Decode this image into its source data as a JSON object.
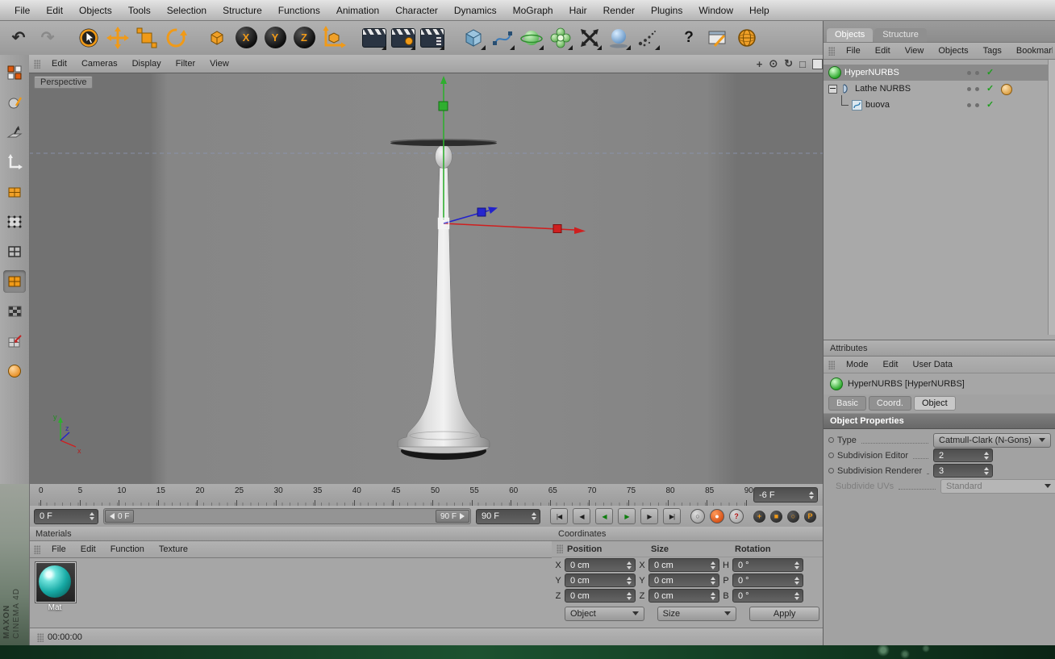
{
  "colors": {
    "accent": "#f09a18",
    "material_teal": "#17a9a4",
    "desktop_green": "#16402a",
    "axis_x": "#cf1f1f",
    "axis_y": "#2fae2f",
    "axis_z": "#2222cc"
  },
  "icons": {
    "undo": "↶",
    "redo": "↷",
    "nav_pan": "+",
    "nav_zoom": "⊙",
    "nav_rotate": "↻",
    "nav_max": "□",
    "goto_start": "|◀",
    "prev_frame": "◀",
    "play_backward": "◀",
    "play_forward": "▶",
    "next_frame": "▶",
    "goto_end": "▶|",
    "autokey": "○",
    "record": "●",
    "keyframe_help": "?",
    "key_position": "+",
    "key_scale": "■",
    "key_rotation": "○",
    "key_parameter": "P",
    "pencil": "╱",
    "check": "✓",
    "help": "?"
  },
  "menubar": {
    "items": [
      "File",
      "Edit",
      "Objects",
      "Tools",
      "Selection",
      "Structure",
      "Functions",
      "Animation",
      "Character",
      "Dynamics",
      "MoGraph",
      "Hair",
      "Render",
      "Plugins",
      "Window",
      "Help"
    ]
  },
  "main_toolbar": {
    "axis_buttons": [
      "X",
      "Y",
      "Z"
    ],
    "icon_names": [
      "undo",
      "redo",
      "live-selection",
      "move",
      "scale",
      "rotate",
      "object-axis",
      "lock-x-axis",
      "lock-y-axis",
      "lock-z-axis",
      "coordinate-system",
      "render-view",
      "render-settings",
      "render-in-picture-viewer",
      "add-primitive-cube",
      "add-spline",
      "add-nurbs",
      "add-modeling-object",
      "add-deformer",
      "add-scene-object",
      "add-particle-emitter",
      "help",
      "layout-browser",
      "online-updater"
    ]
  },
  "mode_toolbar": {
    "icon_names": [
      "make-editable",
      "model-mode",
      "object-mode",
      "axis-mode",
      "texture-mode",
      "points-mode",
      "edges-mode",
      "polygons-mode",
      "workplane-mode",
      "snap-settings",
      "render-preview"
    ]
  },
  "viewport": {
    "menu_items": [
      "Edit",
      "Cameras",
      "Display",
      "Filter",
      "View"
    ],
    "view_label": "Perspective",
    "gizmo": {
      "x": "x",
      "y": "y",
      "z": "z"
    }
  },
  "object_manager": {
    "tabs": {
      "objects": "Objects",
      "structure": "Structure"
    },
    "menu_items": [
      "File",
      "Edit",
      "View",
      "Objects",
      "Tags",
      "Bookmarks"
    ],
    "items": [
      {
        "name": "HyperNURBS"
      },
      {
        "name": "Lathe NURBS"
      },
      {
        "name": "buova"
      }
    ]
  },
  "attribute_manager": {
    "panel_title": "Attributes",
    "menu_items": [
      "Mode",
      "Edit",
      "User Data"
    ],
    "object_header": "HyperNURBS [HyperNURBS]",
    "tabs": {
      "basic": "Basic",
      "coord": "Coord.",
      "object": "Object"
    },
    "section_title": "Object Properties",
    "properties": {
      "type_label": "Type",
      "type_value": "Catmull-Clark (N-Gons)",
      "sub_editor_label": "Subdivision Editor",
      "sub_editor_value": "2",
      "sub_renderer_label": "Subdivision Renderer",
      "sub_renderer_value": "3",
      "sub_uv_label": "Subdivide UVs",
      "sub_uv_value": "Standard"
    }
  },
  "timeline": {
    "ticks": [
      "0",
      "5",
      "10",
      "15",
      "20",
      "25",
      "30",
      "35",
      "40",
      "45",
      "50",
      "55",
      "60",
      "65",
      "70",
      "75",
      "80",
      "85",
      "90"
    ],
    "frame_field": "-6 F",
    "range_start": "0 F",
    "slider_start": "0 F",
    "slider_end": "90 F",
    "range_end": "90 F"
  },
  "materials": {
    "panel_title": "Materials",
    "menu_items": [
      "File",
      "Edit",
      "Function",
      "Texture"
    ],
    "items": [
      {
        "name": "Mat"
      }
    ]
  },
  "coordinates": {
    "panel_title": "Coordinates",
    "col_position": "Position",
    "col_size": "Size",
    "col_rotation": "Rotation",
    "rows": [
      {
        "pl": "X",
        "pv": "0 cm",
        "sl": "X",
        "sv": "0 cm",
        "rl": "H",
        "rv": "0 °"
      },
      {
        "pl": "Y",
        "pv": "0 cm",
        "sl": "Y",
        "sv": "0 cm",
        "rl": "P",
        "rv": "0 °"
      },
      {
        "pl": "Z",
        "pv": "0 cm",
        "sl": "Z",
        "sv": "0 cm",
        "rl": "B",
        "rv": "0 °"
      }
    ],
    "object_dropdown": "Object",
    "size_dropdown": "Size",
    "apply": "Apply"
  },
  "status": {
    "time": "00:00:00"
  },
  "branding": {
    "line1": "MAXON",
    "line2": "CINEMA 4D"
  }
}
